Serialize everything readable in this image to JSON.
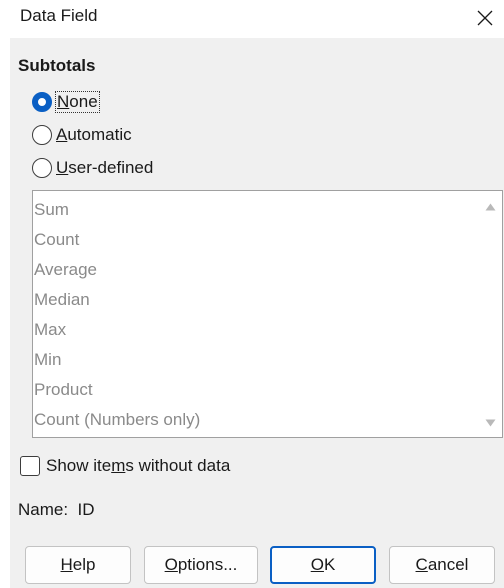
{
  "window": {
    "title": "Data Field",
    "close_icon": "close-icon"
  },
  "subtotals": {
    "heading": "Subtotals",
    "options": [
      {
        "pre": "",
        "key": "N",
        "post": "one",
        "checked": true
      },
      {
        "pre": "",
        "key": "A",
        "post": "utomatic",
        "checked": false
      },
      {
        "pre": "",
        "key": "U",
        "post": "ser-defined",
        "checked": false
      }
    ]
  },
  "functions_list": [
    "Sum",
    "Count",
    "Average",
    "Median",
    "Max",
    "Min",
    "Product",
    "Count (Numbers only)"
  ],
  "show_items_checkbox": {
    "pre": "Show ite",
    "key": "m",
    "post": "s without data",
    "checked": false
  },
  "name_field": {
    "text": "Name:  ID"
  },
  "buttons": {
    "help": {
      "key": "H",
      "post": "elp"
    },
    "options": {
      "key": "O",
      "post": "ptions..."
    },
    "ok": {
      "key": "O",
      "post": "K"
    },
    "cancel": {
      "key": "C",
      "post": "ancel"
    }
  },
  "colors": {
    "accent": "#0a5fc4",
    "disabled_text": "#8a8a8a",
    "panel_bg": "#f0f0f0"
  }
}
